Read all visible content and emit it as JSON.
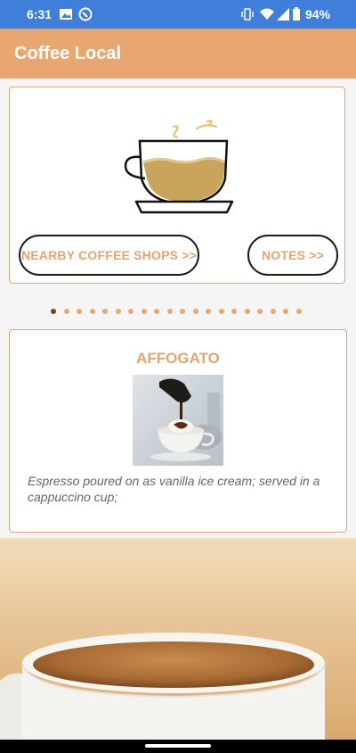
{
  "status_bar": {
    "time": "6:31",
    "battery_percent": "94%",
    "icons": [
      "image-icon",
      "no-disturb-icon",
      "vibrate-icon",
      "wifi-icon",
      "signal-icon",
      "battery-icon"
    ]
  },
  "app_bar": {
    "title": "Coffee Local"
  },
  "hero": {
    "illustration": "coffee-cup-icon",
    "buttons": {
      "nearby": "NEARBY COFFEE SHOPS >>",
      "notes": "NOTES >>"
    }
  },
  "pager": {
    "total": 20,
    "active_index": 0,
    "active_color": "#8b3a1c",
    "inactive_color": "#e8a670"
  },
  "drink": {
    "name": "AFFOGATO",
    "image": "affogato-photo",
    "description": "Espresso poured on as vanilla ice cream; served in a cappuccino cup;"
  },
  "bottom_image": "coffee-cup-photo",
  "colors": {
    "accent": "#e8a670",
    "text_accent": "#e3a474",
    "status_bar": "#3f7fd9"
  }
}
